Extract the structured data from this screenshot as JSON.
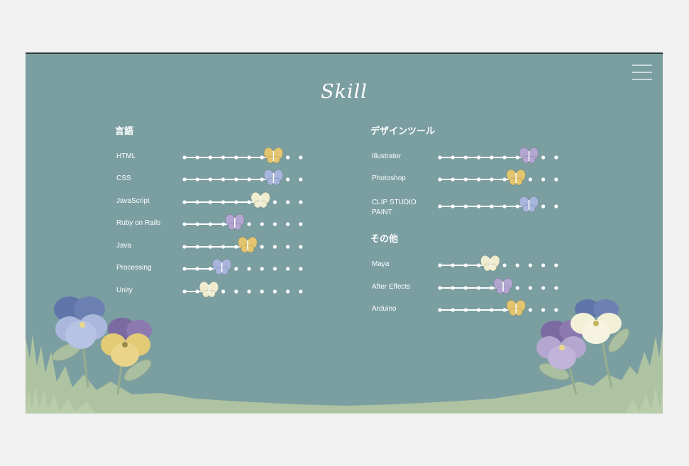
{
  "app": {
    "logo": "Skill"
  },
  "menu": {
    "icon": "hamburger-menu-icon"
  },
  "sections": {
    "languages": {
      "title": "言語",
      "items": [
        {
          "name": "HTML",
          "level": 7,
          "max": 9,
          "butterfly": "#e2c56e"
        },
        {
          "name": "CSS",
          "level": 7,
          "max": 9,
          "butterfly": "#a7b4db"
        },
        {
          "name": "JavaScript",
          "level": 6,
          "max": 9,
          "butterfly": "#efeccf"
        },
        {
          "name": "Ruby on Rails",
          "level": 4,
          "max": 9,
          "butterfly": "#b2a5d0"
        },
        {
          "name": "Java",
          "level": 5,
          "max": 9,
          "butterfly": "#e2c56e"
        },
        {
          "name": "Processing",
          "level": 3,
          "max": 9,
          "butterfly": "#a7b4db"
        },
        {
          "name": "Unity",
          "level": 2,
          "max": 9,
          "butterfly": "#efeccf"
        }
      ]
    },
    "design_tools": {
      "title": "デザインツール",
      "items": [
        {
          "name": "Illustrator",
          "level": 7,
          "max": 9,
          "butterfly": "#b2a5d0"
        },
        {
          "name": "Photoshop",
          "level": 6,
          "max": 9,
          "butterfly": "#e2c56e"
        },
        {
          "name": "CLIP STUDIO PAINT",
          "name_line1": "CLIP STUDIO",
          "name_line2": "PAINT",
          "level": 7,
          "max": 9,
          "butterfly": "#a7b4db"
        }
      ]
    },
    "others": {
      "title": "その他",
      "items": [
        {
          "name": "Maya",
          "level": 4,
          "max": 9,
          "butterfly": "#efeccf"
        },
        {
          "name": "After Effects",
          "level": 5,
          "max": 9,
          "butterfly": "#b2a5d0"
        },
        {
          "name": "Arduino",
          "level": 6,
          "max": 9,
          "butterfly": "#e2c56e"
        }
      ]
    }
  },
  "colors": {
    "background": "#7b9ea1",
    "page": "#f1f1f1",
    "grass": "#aec3a1",
    "flower_blue": "#9fb1d6",
    "flower_purple": "#b3a6cf",
    "flower_yellow": "#e3cb75",
    "flower_cream": "#f2f0d7"
  }
}
